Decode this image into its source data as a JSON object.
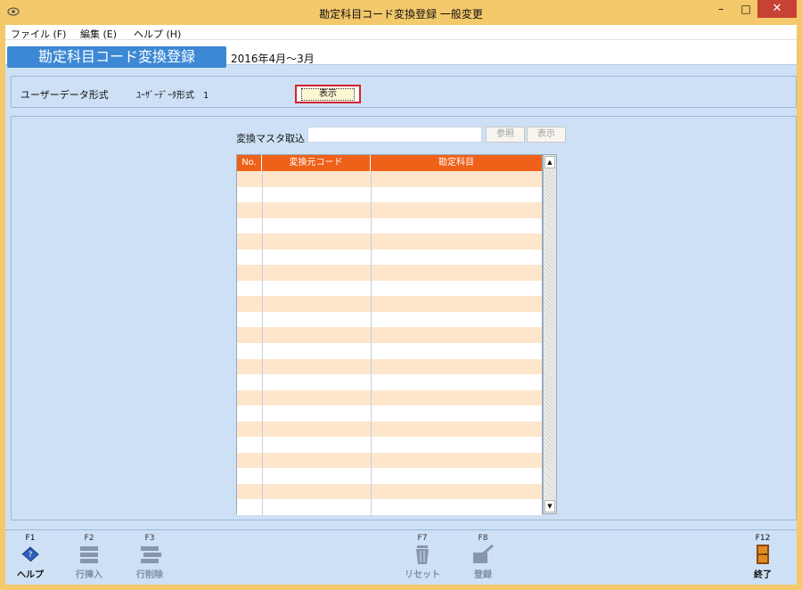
{
  "window": {
    "title": "勘定科目コード変換登録 一般変更",
    "min_glyph": "–",
    "max_glyph": "□",
    "close_glyph": "✕"
  },
  "menu": {
    "items": [
      "ファイル (F)",
      "編集 (E)",
      "ヘルプ (H)"
    ]
  },
  "header": {
    "screen_title": "勘定科目コード変換登録",
    "period": "2016年4月～3月"
  },
  "user_data": {
    "label": "ユーザーデータ形式",
    "value": "ﾕｰｻﾞｰﾃﾞｰﾀ形式　1",
    "display_button": "表示"
  },
  "import": {
    "label": "変換マスタ取込",
    "input_value": "",
    "ref_button": "参照",
    "show_button": "表示"
  },
  "grid": {
    "columns": [
      "No.",
      "変換元コード",
      "勘定科目"
    ],
    "row_count": 22,
    "rows": []
  },
  "function_keys": [
    {
      "key": "F1",
      "label": "ヘルプ",
      "icon": "help-book-icon",
      "enabled": true
    },
    {
      "key": "F2",
      "label": "行挿入",
      "icon": "insert-row-icon",
      "enabled": false
    },
    {
      "key": "F3",
      "label": "行削除",
      "icon": "delete-row-icon",
      "enabled": false
    },
    {
      "key": "F7",
      "label": "リセット",
      "icon": "trash-icon",
      "enabled": false
    },
    {
      "key": "F8",
      "label": "登録",
      "icon": "register-icon",
      "enabled": false
    },
    {
      "key": "F12",
      "label": "終了",
      "icon": "exit-door-icon",
      "enabled": true
    }
  ],
  "colors": {
    "frame": "#f4c96b",
    "client_bg": "#cde0f5",
    "title_badge": "#3c88d4",
    "grid_header": "#ef6018",
    "grid_alt_row": "#fde6cc",
    "highlight_border": "#d4232a"
  }
}
